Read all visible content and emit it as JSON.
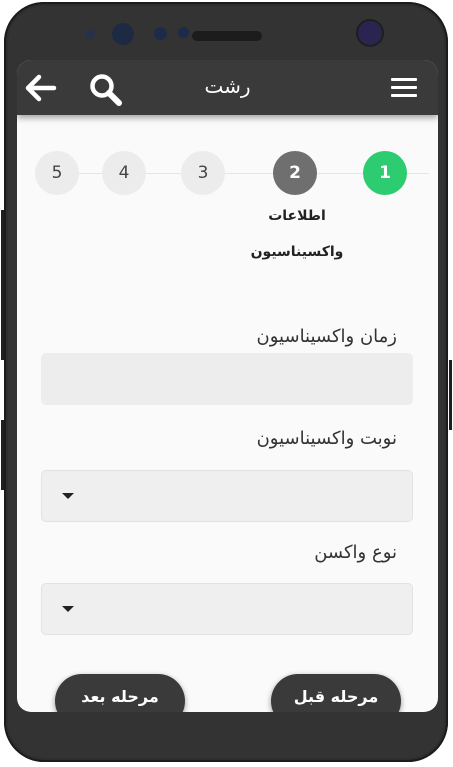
{
  "app_bar": {
    "title": "رشت",
    "menu_icon": "hamburger-menu-icon",
    "search_icon": "search-icon",
    "back_icon": "arrow-left-icon"
  },
  "stepper": {
    "steps": [
      "1",
      "2",
      "3",
      "4",
      "5"
    ],
    "current_step_label_line1": "اطلاعات",
    "current_step_label_line2": "واکسیناسیون"
  },
  "form": {
    "vaccination_time_label": "زمان واکسیناسیون",
    "vaccination_time_value": "",
    "vaccination_dose_label": "نوبت واکسیناسیون",
    "vaccination_dose_value": "",
    "vaccine_type_label": "نوع واکسن",
    "vaccine_type_value": ""
  },
  "actions": {
    "previous_label": "مرحله قبل",
    "next_label": "مرحله بعد"
  },
  "colors": {
    "app_bar": "#3a3a3a",
    "step_done": "#2ecc71",
    "step_active": "#6f6f6f",
    "step_pending": "#ececec",
    "background": "#fafafa"
  }
}
